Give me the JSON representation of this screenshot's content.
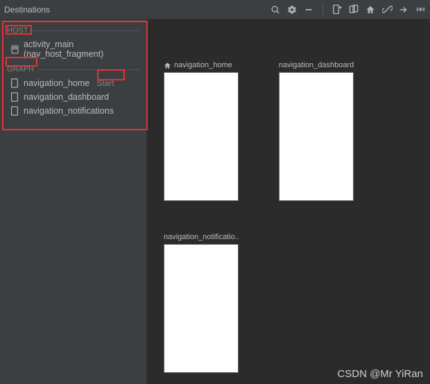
{
  "toolbar": {
    "title": "Destinations"
  },
  "sections": {
    "host_label": "HOST",
    "graph_label": "GRAPH"
  },
  "host_item": {
    "label": "activity_main (nav_host_fragment)"
  },
  "graph_items": [
    {
      "label": "navigation_home",
      "badge": "Start"
    },
    {
      "label": "navigation_dashboard"
    },
    {
      "label": "navigation_notifications"
    }
  ],
  "previews": {
    "home": "navigation_home",
    "dashboard": "navigation_dashboard",
    "notifications": "navigation_notificatio..."
  },
  "watermark": "CSDN @Mr YiRan"
}
